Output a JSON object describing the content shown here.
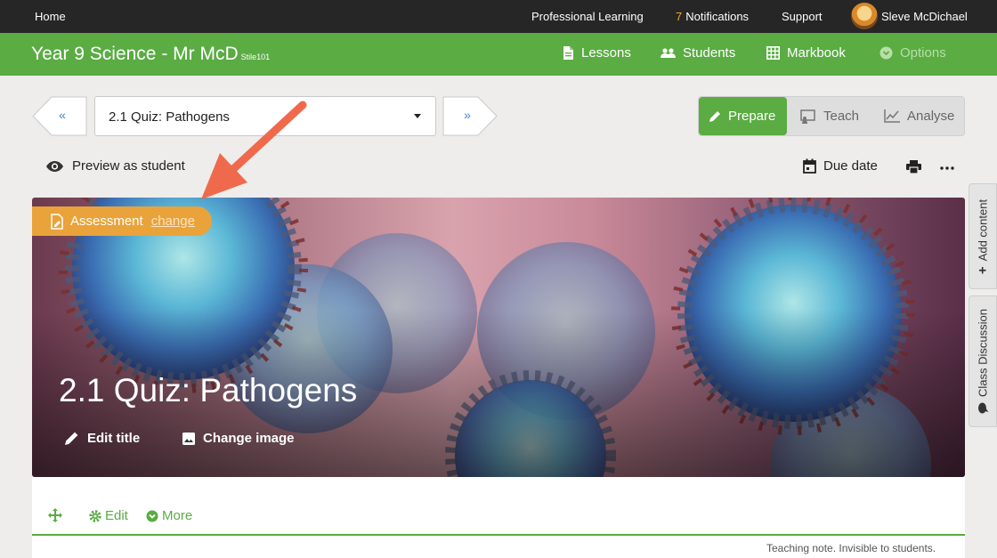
{
  "topbar": {
    "home": "Home",
    "professional_learning": "Professional Learning",
    "notifications_count": "7",
    "notifications_label": "Notifications",
    "support": "Support",
    "user_name": "Sleve McDichael"
  },
  "classbar": {
    "title": "Year 9 Science - Mr McD",
    "code": "Stile101",
    "nav": {
      "lessons": "Lessons",
      "students": "Students",
      "markbook": "Markbook",
      "options": "Options"
    }
  },
  "selector": {
    "prev": "«",
    "next": "»",
    "selected": "2.1 Quiz: Pathogens"
  },
  "modes": {
    "prepare": "Prepare",
    "teach": "Teach",
    "analyse": "Analyse",
    "active": "prepare"
  },
  "toolbar": {
    "preview": "Preview as student",
    "due_date": "Due date"
  },
  "hero": {
    "badge": "Assessment",
    "badge_change": "change",
    "title": "2.1 Quiz: Pathogens",
    "edit_title": "Edit title",
    "change_image": "Change image"
  },
  "sidetabs": {
    "add_content": "Add content",
    "class_discussion": "Class Discussion"
  },
  "panel": {
    "edit": "Edit",
    "more": "More",
    "teaching_note": "Teaching note. Invisible to students."
  },
  "colors": {
    "brand_green": "#5aac43",
    "assessment_orange": "#e9a33a",
    "annotation_arrow": "#ef6a4c"
  }
}
